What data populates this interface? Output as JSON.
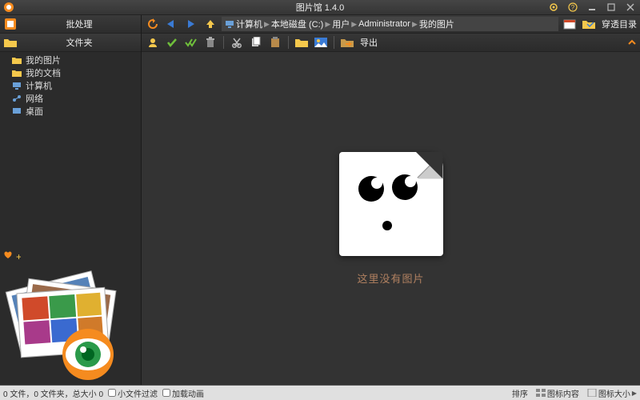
{
  "titlebar": {
    "title": "图片馆 1.4.0"
  },
  "sidebar": {
    "header1": {
      "label": "批处理"
    },
    "header2": {
      "label": "文件夹"
    },
    "tree": [
      {
        "label": "我的图片",
        "icon": "folder-image-icon",
        "color": "#f5c84c"
      },
      {
        "label": "我的文档",
        "icon": "folder-doc-icon",
        "color": "#f5c84c"
      },
      {
        "label": "计算机",
        "icon": "computer-icon",
        "color": "#6aa0d8"
      },
      {
        "label": "网络",
        "icon": "network-icon",
        "color": "#6aa0d8"
      },
      {
        "label": "桌面",
        "icon": "desktop-icon",
        "color": "#6aa0d8"
      }
    ]
  },
  "breadcrumb": [
    {
      "label": "计算机"
    },
    {
      "label": "本地磁盘 (C:)"
    },
    {
      "label": "用户"
    },
    {
      "label": "Administrator"
    },
    {
      "label": "我的图片"
    }
  ],
  "navbar": {
    "penetrate_label": "穿透目录"
  },
  "toolbar": {
    "export_label": "导出"
  },
  "content": {
    "empty_text": "这里没有图片"
  },
  "status": {
    "summary": "0 文件，0 文件夹，总大小 0",
    "filter_small": "小文件过滤",
    "anim": "加载动画",
    "sort": "排序",
    "thumb_content": "图标内容",
    "thumb_size": "图标大小"
  },
  "colors": {
    "accent": "#f58b1f",
    "green": "#6fbf3b",
    "blue": "#3a7bd5"
  }
}
